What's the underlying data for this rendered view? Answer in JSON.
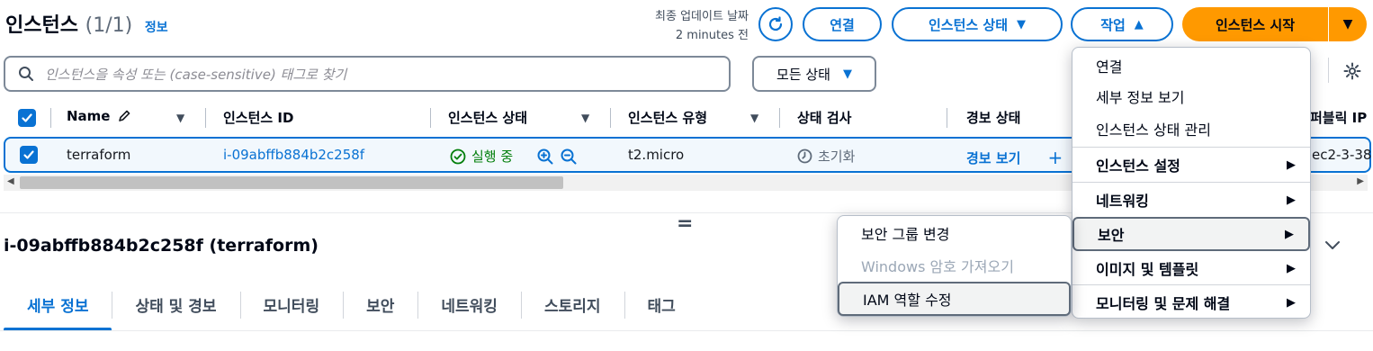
{
  "header": {
    "title": "인스턴스",
    "count": "(1/1)",
    "info_link": "정보",
    "updated_label": "최종 업데이트 날짜",
    "updated_value": "2 minutes 전"
  },
  "toolbar": {
    "connect_label": "연결",
    "instance_state_label": "인스턴스 상태",
    "actions_label": "작업",
    "launch_label": "인스턴스 시작"
  },
  "filter": {
    "search_placeholder": "인스턴스을 속성 또는 (case-sensitive) 태그로 찾기",
    "state_filter": "모든 상태"
  },
  "table": {
    "columns": [
      "Name",
      "인스턴스 ID",
      "인스턴스 상태",
      "인스턴스 유형",
      "상태 검사",
      "경보 상태",
      "퍼블릭 IP"
    ],
    "rows": [
      {
        "name": "terraform",
        "instance_id": "i-09abffb884b2c258f",
        "state": "실행 중",
        "type": "t2.micro",
        "status_check": "초기화",
        "alarm": "경보 보기",
        "public_ip": "ec2-3-38"
      }
    ]
  },
  "detail": {
    "title": "i-09abffb884b2c258f (terraform)",
    "tabs": [
      "세부 정보",
      "상태 및 경보",
      "모니터링",
      "보안",
      "네트워킹",
      "스토리지",
      "태그"
    ]
  },
  "actions_menu": {
    "items": [
      "연결",
      "세부 정보 보기",
      "인스턴스 상태 관리",
      "인스턴스 설정",
      "네트워킹",
      "보안",
      "이미지 및 템플릿",
      "모니터링 및 문제 해결"
    ]
  },
  "security_submenu": {
    "items": [
      "보안 그룹 변경",
      "Windows 암호 가져오기",
      "IAM 역할 수정"
    ]
  },
  "colors": {
    "accent": "#0972d3",
    "primary": "#ff9900",
    "running": "#037f0c"
  }
}
